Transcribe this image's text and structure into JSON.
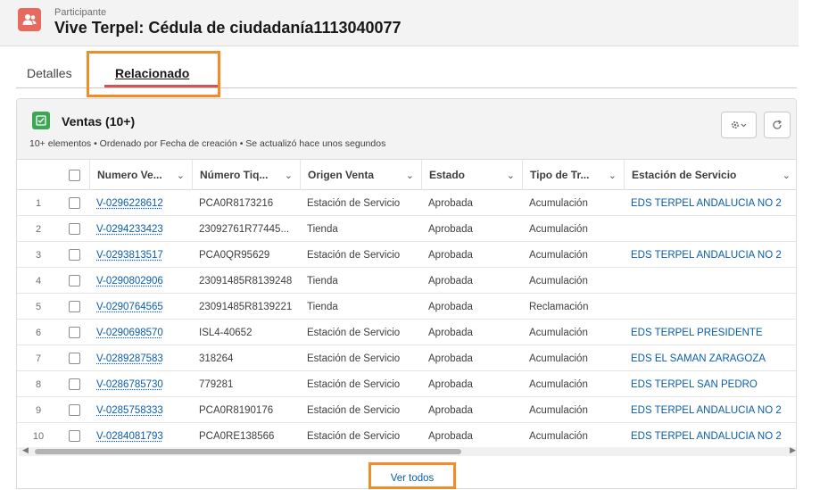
{
  "record": {
    "type": "Participante",
    "title": "Vive Terpel: Cédula de ciudadanía1113040077",
    "icon": "person-group-icon"
  },
  "tabs": [
    {
      "label": "Detalles",
      "active": false
    },
    {
      "label": "Relacionado",
      "active": true
    }
  ],
  "related_list": {
    "title": "Ventas (10+)",
    "subtitle": "10+ elementos • Ordenado por Fecha de creación • Se actualizó hace unos segundos",
    "icon": "sales-list-icon",
    "gear_icon": "gear-icon",
    "refresh_icon": "refresh-icon",
    "columns": [
      "Numero Ve...",
      "Número Tiq...",
      "Origen Venta",
      "Estado",
      "Tipo de Tr...",
      "Estación de Servicio"
    ],
    "rows": [
      {
        "n": "1",
        "numero": "V-0296228612",
        "tiquete": "PCA0R8173216",
        "origen": "Estación de Servicio",
        "estado": "Aprobada",
        "tipo": "Acumulación",
        "estacion": "EDS TERPEL ANDALUCIA NO 2"
      },
      {
        "n": "2",
        "numero": "V-0294233423",
        "tiquete": "23092761R77445...",
        "origen": "Tienda",
        "estado": "Aprobada",
        "tipo": "Acumulación",
        "estacion": ""
      },
      {
        "n": "3",
        "numero": "V-0293813517",
        "tiquete": "PCA0QR95629",
        "origen": "Estación de Servicio",
        "estado": "Aprobada",
        "tipo": "Acumulación",
        "estacion": "EDS TERPEL ANDALUCIA NO 2"
      },
      {
        "n": "4",
        "numero": "V-0290802906",
        "tiquete": "23091485R8139248",
        "origen": "Tienda",
        "estado": "Aprobada",
        "tipo": "Acumulación",
        "estacion": ""
      },
      {
        "n": "5",
        "numero": "V-0290764565",
        "tiquete": "23091485R8139221",
        "origen": "Tienda",
        "estado": "Aprobada",
        "tipo": "Reclamación",
        "estacion": ""
      },
      {
        "n": "6",
        "numero": "V-0290698570",
        "tiquete": "ISL4-40652",
        "origen": "Estación de Servicio",
        "estado": "Aprobada",
        "tipo": "Acumulación",
        "estacion": "EDS TERPEL PRESIDENTE"
      },
      {
        "n": "7",
        "numero": "V-0289287583",
        "tiquete": "318264",
        "origen": "Estación de Servicio",
        "estado": "Aprobada",
        "tipo": "Acumulación",
        "estacion": "EDS EL SAMAN ZARAGOZA"
      },
      {
        "n": "8",
        "numero": "V-0286785730",
        "tiquete": "779281",
        "origen": "Estación de Servicio",
        "estado": "Aprobada",
        "tipo": "Acumulación",
        "estacion": "EDS TERPEL SAN PEDRO"
      },
      {
        "n": "9",
        "numero": "V-0285758333",
        "tiquete": "PCA0R8190176",
        "origen": "Estación de Servicio",
        "estado": "Aprobada",
        "tipo": "Acumulación",
        "estacion": "EDS TERPEL ANDALUCIA NO 2"
      },
      {
        "n": "10",
        "numero": "V-0284081793",
        "tiquete": "PCA0RE138566",
        "origen": "Estación de Servicio",
        "estado": "Aprobada",
        "tipo": "Acumulación",
        "estacion": "EDS TERPEL ANDALUCIA NO 2"
      }
    ],
    "view_all": "Ver todos"
  },
  "colors": {
    "accent_link": "#0b5cab",
    "highlight": "#f28c28",
    "record_icon": "#e76a5f",
    "list_icon": "#3ba755"
  }
}
